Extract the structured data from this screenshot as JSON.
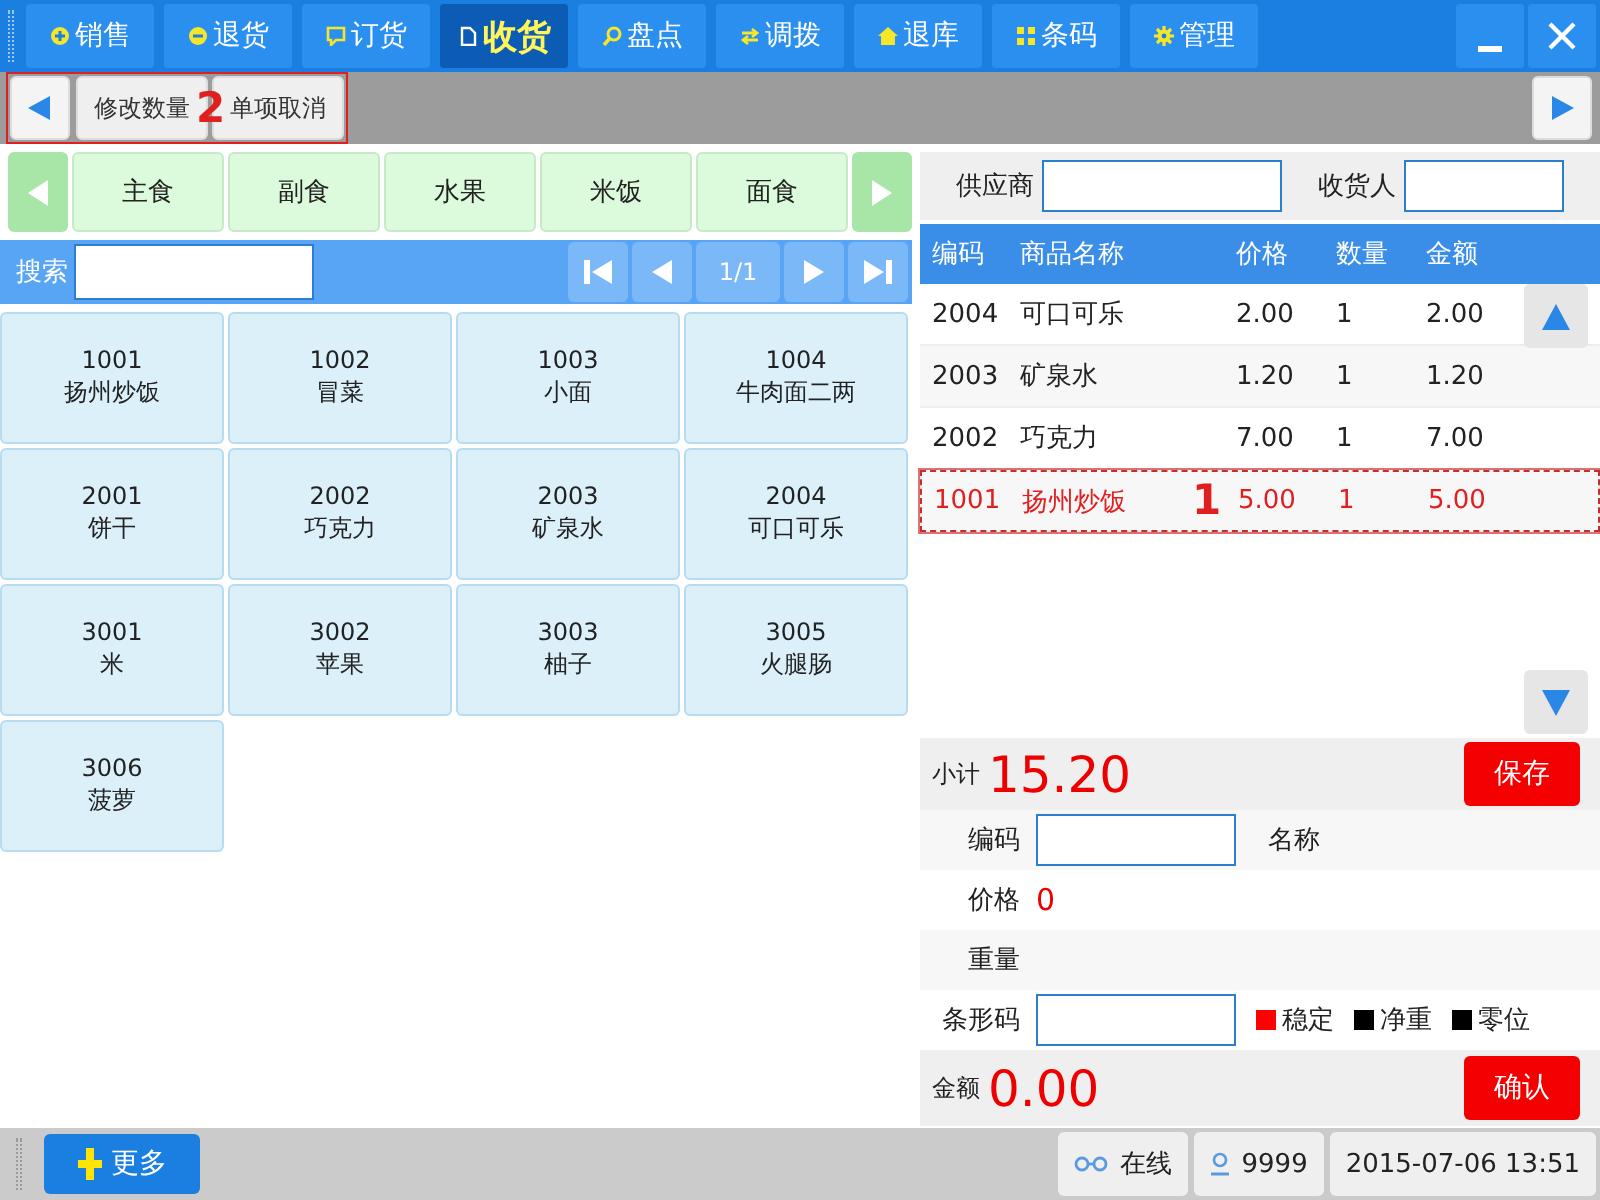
{
  "tabs": [
    {
      "label": "销售",
      "selected": false
    },
    {
      "label": "退货",
      "selected": false
    },
    {
      "label": "订货",
      "selected": false
    },
    {
      "label": "收货",
      "selected": true
    },
    {
      "label": "盘点",
      "selected": false
    },
    {
      "label": "调拨",
      "selected": false
    },
    {
      "label": "退库",
      "selected": false
    },
    {
      "label": "条码",
      "selected": false
    },
    {
      "label": "管理",
      "selected": false
    }
  ],
  "toolbar": {
    "buttons": [
      "修改数量",
      "单项取消"
    ]
  },
  "categories": [
    {
      "label": "主食"
    },
    {
      "label": "副食"
    },
    {
      "label": "水果"
    },
    {
      "label": "米饭"
    },
    {
      "label": "面食"
    }
  ],
  "search": {
    "label": "搜索",
    "page": "1/1"
  },
  "products": [
    {
      "code": "1001",
      "name": "扬州炒饭"
    },
    {
      "code": "1002",
      "name": "冒菜"
    },
    {
      "code": "1003",
      "name": "小面"
    },
    {
      "code": "1004",
      "name": "牛肉面二两"
    },
    {
      "code": "2001",
      "name": "饼干"
    },
    {
      "code": "2002",
      "name": "巧克力"
    },
    {
      "code": "2003",
      "name": "矿泉水"
    },
    {
      "code": "2004",
      "name": "可口可乐"
    },
    {
      "code": "3001",
      "name": "米"
    },
    {
      "code": "3002",
      "name": "苹果"
    },
    {
      "code": "3003",
      "name": "柚子"
    },
    {
      "code": "3005",
      "name": "火腿肠"
    },
    {
      "code": "3006",
      "name": "菠萝"
    }
  ],
  "order": {
    "supplier_label": "供应商",
    "receiver_label": "收货人",
    "columns": [
      "编码",
      "商品名称",
      "价格",
      "数量",
      "金额"
    ],
    "rows": [
      {
        "cells": [
          "2004",
          "可口可乐",
          "2.00",
          "1",
          "2.00"
        ],
        "selected": false
      },
      {
        "cells": [
          "2003",
          "矿泉水",
          "1.20",
          "1",
          "1.20"
        ],
        "selected": false
      },
      {
        "cells": [
          "2002",
          "巧克力",
          "7.00",
          "1",
          "7.00"
        ],
        "selected": false
      },
      {
        "cells": [
          "1001",
          "扬州炒饭",
          "5.00",
          "1",
          "5.00"
        ],
        "selected": true
      }
    ],
    "subtotal_label": "小计",
    "subtotal": "15.20",
    "save_button": "保存"
  },
  "entry": {
    "code_label": "编码",
    "name_label": "名称",
    "price_label": "价格",
    "price": "0",
    "weight_label": "重量",
    "barcode_label": "条形码",
    "indicators": [
      {
        "label": "稳定",
        "color": "#ff0000"
      },
      {
        "label": "净重",
        "color": "#000000"
      },
      {
        "label": "零位",
        "color": "#000000"
      }
    ],
    "amount_label": "金额",
    "amount": "0.00",
    "confirm_button": "确认"
  },
  "status_bar": {
    "more_button": "更多",
    "online": "在线",
    "user": "9999",
    "datetime": "2015-07-06 13:51"
  },
  "annotations": [
    {
      "label": "1"
    },
    {
      "label": "2"
    }
  ]
}
